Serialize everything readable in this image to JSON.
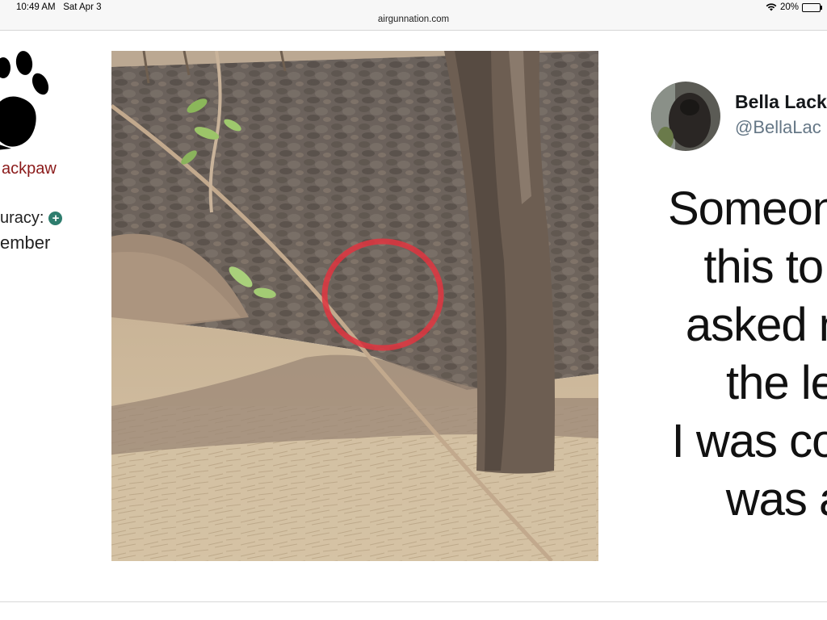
{
  "status_bar": {
    "time": "10:49 AM",
    "date": "Sat Apr 3",
    "battery": "20%",
    "battery_level": 0.2
  },
  "browser": {
    "url": "airgunnation.com"
  },
  "profile": {
    "username": "ackpaw",
    "accuracy_label": "uracy:",
    "member_label": "ember",
    "accent": "#8b1a1a"
  },
  "photo": {
    "marker_color": "#e0353f"
  },
  "tweet": {
    "name": "Bella Lack",
    "handle": "@BellaLac",
    "lines": [
      "Someon",
      "this to r",
      "asked n",
      "the le",
      "I was co",
      "was a"
    ]
  }
}
